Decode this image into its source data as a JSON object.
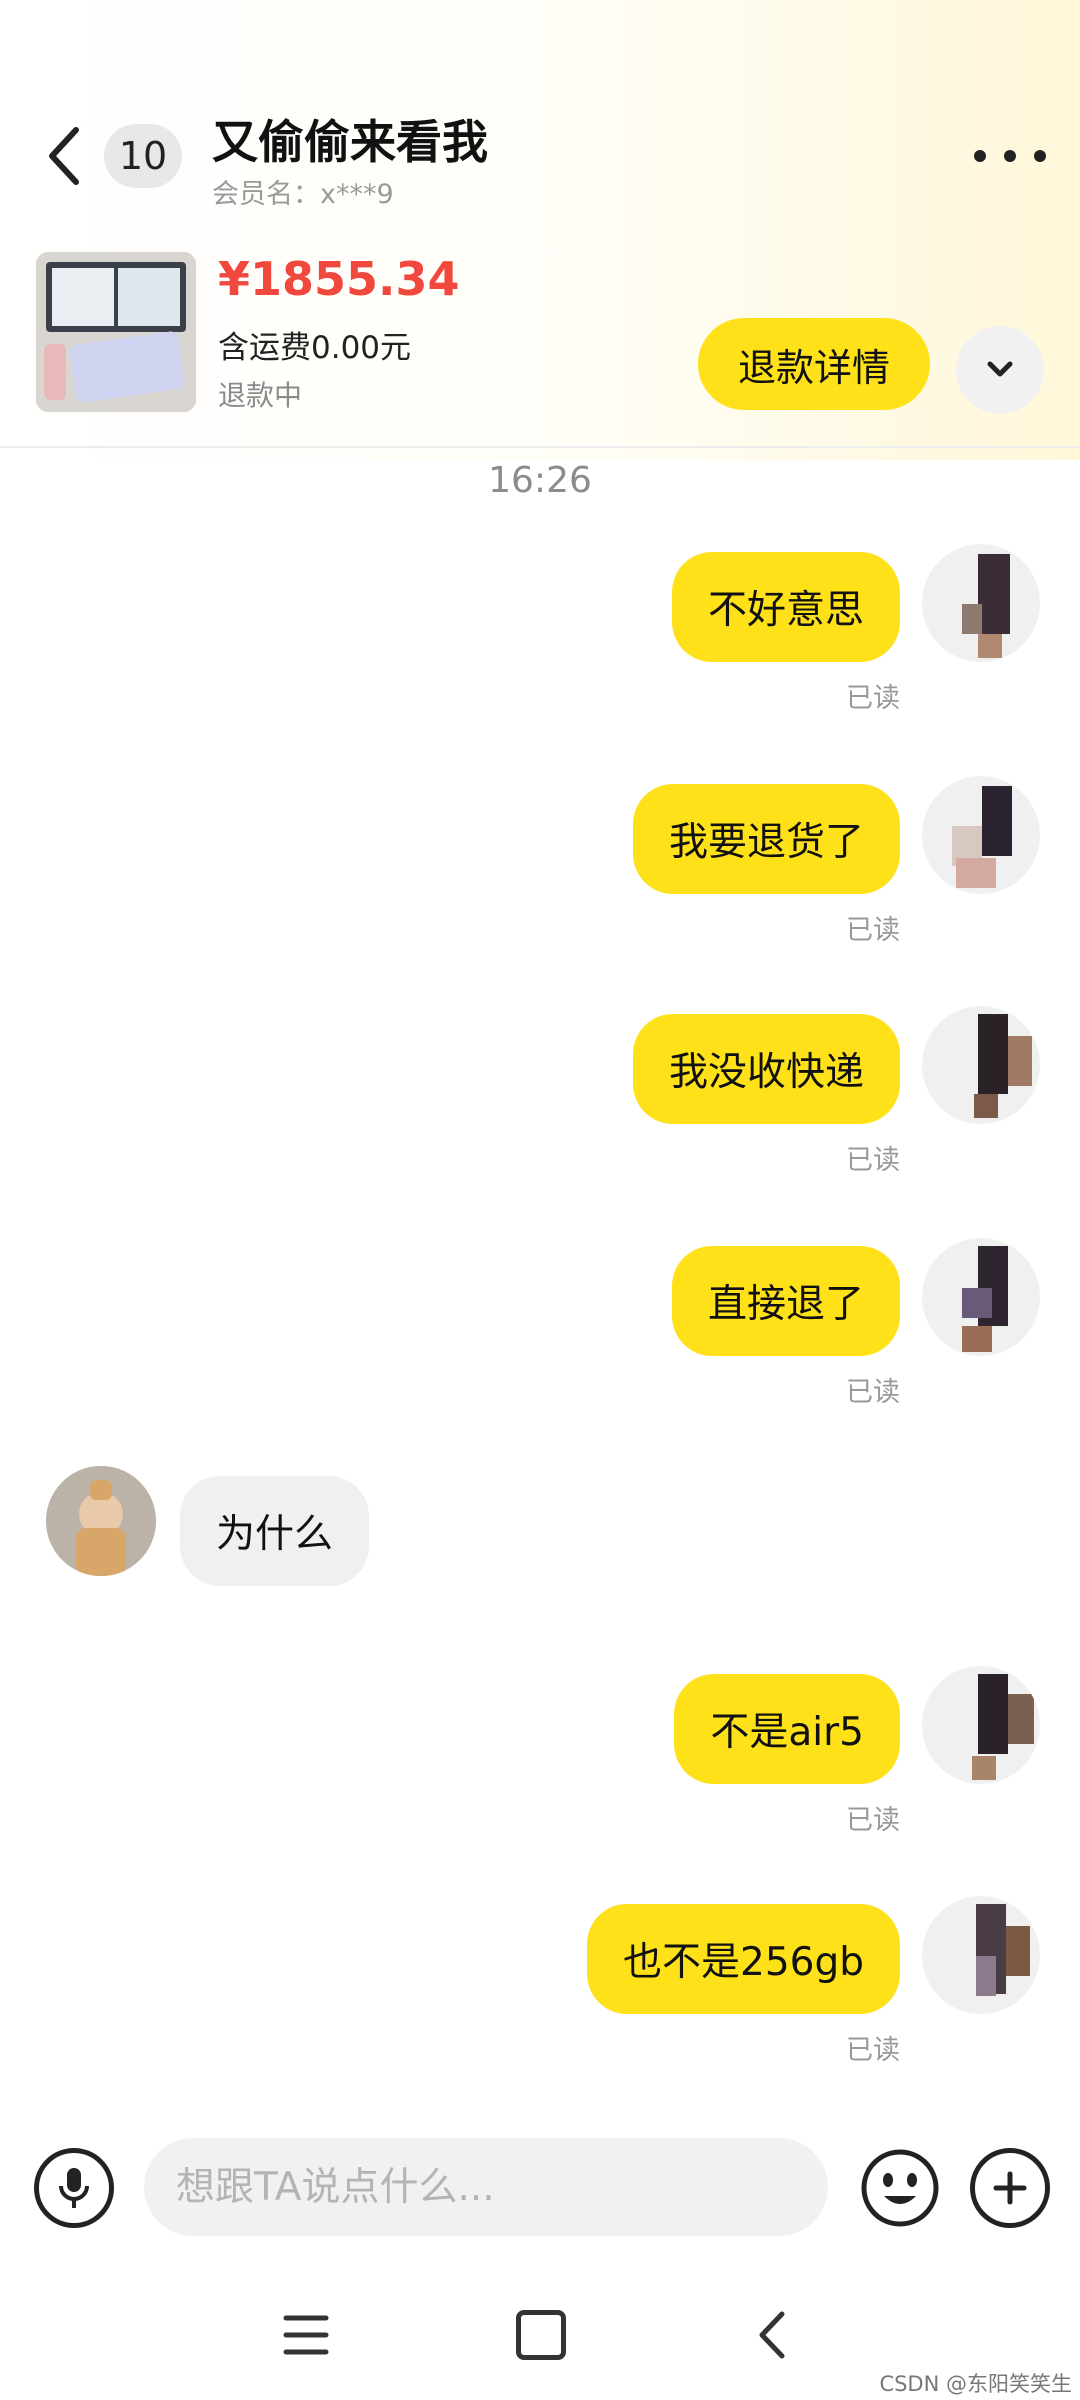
{
  "header": {
    "unread_count": "10",
    "title": "又偷偷来看我",
    "member": "会员名：x***9"
  },
  "order": {
    "price": "¥1855.34",
    "shipping": "含运费0.00元",
    "status": "退款中",
    "refund_button": "退款详情"
  },
  "chat": {
    "timestamp": "16:26",
    "read_label": "已读",
    "messages": [
      {
        "from": "me",
        "text": "不好意思"
      },
      {
        "from": "me",
        "text": "我要退货了"
      },
      {
        "from": "me",
        "text": "我没收快递"
      },
      {
        "from": "me",
        "text": "直接退了"
      },
      {
        "from": "them",
        "text": "为什么"
      },
      {
        "from": "me",
        "text": "不是air5"
      },
      {
        "from": "me",
        "text": "也不是256gb"
      }
    ]
  },
  "input": {
    "placeholder": "想跟TA说点什么..."
  },
  "watermark": "CSDN @东阳笑笑生",
  "colors": {
    "accent_yellow": "#ffe11a",
    "price_red": "#f0483c"
  },
  "icons": [
    "back-arrow-icon",
    "more-dots-icon",
    "chevron-down-icon",
    "microphone-icon",
    "emoji-icon",
    "plus-icon",
    "menu-icon",
    "home-icon",
    "nav-back-icon"
  ]
}
